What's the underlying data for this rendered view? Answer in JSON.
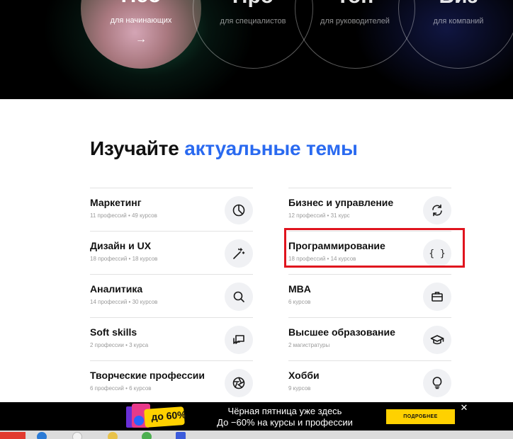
{
  "hero": {
    "levels": [
      {
        "title": "Нео",
        "subtitle": "для начинающих",
        "arrow": "→"
      },
      {
        "title": "Про",
        "subtitle": "для специалистов"
      },
      {
        "title": "Топ",
        "subtitle": "для руководителей"
      },
      {
        "title": "Биз",
        "subtitle": "для компаний"
      }
    ]
  },
  "section": {
    "title_main": "Изучайте",
    "title_accent": "актуальные темы"
  },
  "topics_left": [
    {
      "name": "Маркетинг",
      "meta": "11 профессий • 49 курсов",
      "icon": "pie-chart-icon"
    },
    {
      "name": "Дизайн и UX",
      "meta": "18 профессий • 18 курсов",
      "icon": "magic-wand-icon"
    },
    {
      "name": "Аналитика",
      "meta": "14 профессий • 30 курсов",
      "icon": "search-icon"
    },
    {
      "name": "Soft skills",
      "meta": "2 профессии • 3 курса",
      "icon": "chat-icon"
    },
    {
      "name": "Творческие профессии",
      "meta": "6 профессий • 6 курсов",
      "icon": "aperture-icon"
    }
  ],
  "topics_right": [
    {
      "name": "Бизнес и управление",
      "meta": "12 профессий • 31 курс",
      "icon": "refresh-icon"
    },
    {
      "name": "Программирование",
      "meta": "18 профессий • 14 курсов",
      "icon": "code-braces-icon",
      "icon_text": "{ }"
    },
    {
      "name": "MBA",
      "meta": "6 курсов",
      "icon": "briefcase-icon"
    },
    {
      "name": "Высшее образование",
      "meta": "2 магистратуры",
      "icon": "graduation-cap-icon"
    },
    {
      "name": "Хобби",
      "meta": "9 курсов",
      "icon": "lightbulb-icon"
    }
  ],
  "promo": {
    "badge": "до 60%",
    "line1": "Чёрная пятница уже здесь",
    "line2": "До −60% на курсы и профессии",
    "button": "ПОДРОБНЕЕ",
    "close": "✕"
  },
  "colors": {
    "accent": "#2a6af0",
    "highlight": "#e0141e",
    "promo_button": "#ffd100"
  }
}
